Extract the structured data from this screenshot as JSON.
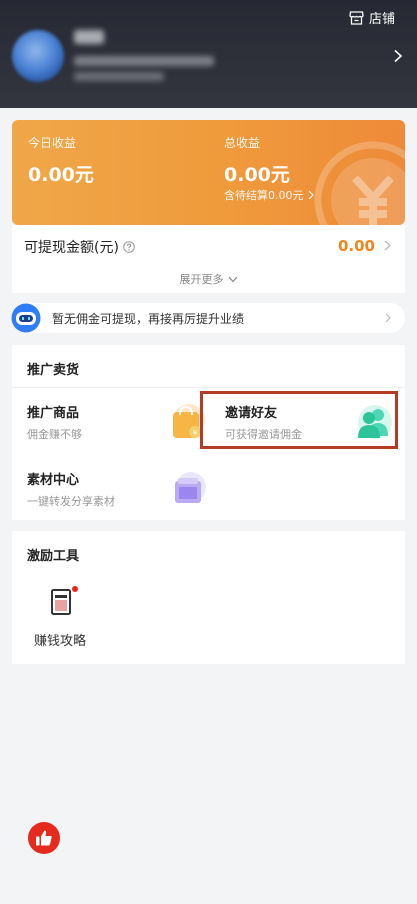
{
  "header": {
    "store_label": "店铺",
    "icons": {
      "store": "store-icon",
      "chevron": "chevron-right-icon"
    }
  },
  "earnings": {
    "today_label": "今日收益",
    "today_value": "0.00元",
    "total_label": "总收益",
    "total_value": "0.00元",
    "pending_text": "含待结算0.00元"
  },
  "withdraw": {
    "label": "可提现金额(元)",
    "value": "0.00",
    "expand_label": "展开更多"
  },
  "notice": {
    "text": "暂无佣金可提现，再接再厉提升业绩"
  },
  "promote": {
    "title": "推广卖货",
    "items": [
      {
        "title": "推广商品",
        "subtitle": "佣金赚不够",
        "icon": "shopping-bag-icon"
      },
      {
        "title": "邀请好友",
        "subtitle": "可获得邀请佣金",
        "icon": "invite-friends-icon"
      },
      {
        "title": "素材中心",
        "subtitle": "一键转发分享素材",
        "icon": "material-folder-icon"
      }
    ]
  },
  "incentive": {
    "title": "激励工具",
    "tools": [
      {
        "label": "赚钱攻略",
        "icon": "guide-book-icon",
        "has_badge": true
      }
    ]
  },
  "colors": {
    "header_bg": "#2b2d37",
    "earn_card": "#ef9a3b",
    "accent_orange": "#f0861e",
    "highlight_border": "#b43b26",
    "like_button": "#e52a1e"
  }
}
